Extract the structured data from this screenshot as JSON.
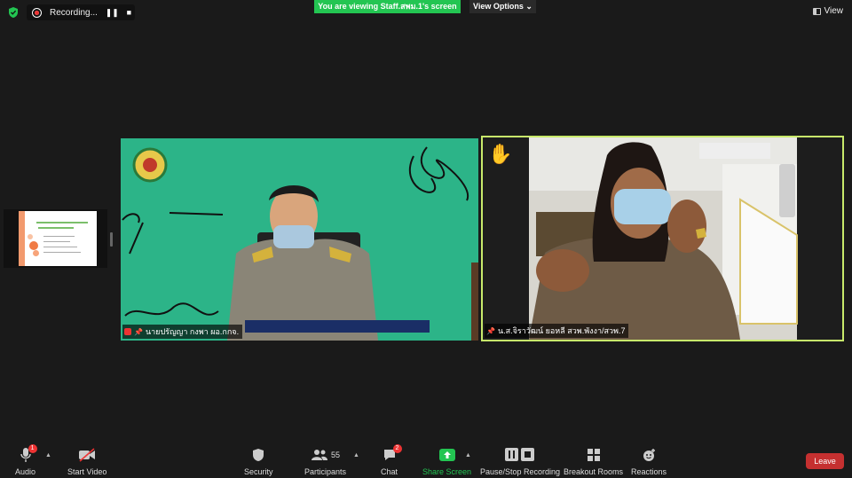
{
  "topbar": {
    "recording_label": "Recording...",
    "pause_icon": "pause-icon",
    "stop_icon": "stop-icon",
    "banner_text": "You are viewing Staff.สพม.1's screen",
    "view_options_label": "View Options",
    "view_label": "View"
  },
  "colors": {
    "banner_green": "#23c552",
    "active_speaker_border": "#c8ea6b",
    "leave_red": "#c53030",
    "tile1_bg": "#2cb488"
  },
  "participants": [
    {
      "name": "นายปรัญญา กงพา ผอ.กกจ.",
      "muted": true
    },
    {
      "name": "น.ส.จิราวัฒน์ ยอหลี สวพ.พังงา/สวพ.7",
      "hand_raised": true
    }
  ],
  "toolbar": {
    "audio": {
      "label": "Audio",
      "badge": "1"
    },
    "video": {
      "label": "Start Video"
    },
    "security": {
      "label": "Security"
    },
    "participants": {
      "label": "Participants",
      "count": "55"
    },
    "chat": {
      "label": "Chat",
      "badge": "2"
    },
    "share": {
      "label": "Share Screen"
    },
    "recording": {
      "label": "Pause/Stop Recording"
    },
    "breakout": {
      "label": "Breakout Rooms"
    },
    "reactions": {
      "label": "Reactions"
    },
    "leave": {
      "label": "Leave"
    }
  }
}
